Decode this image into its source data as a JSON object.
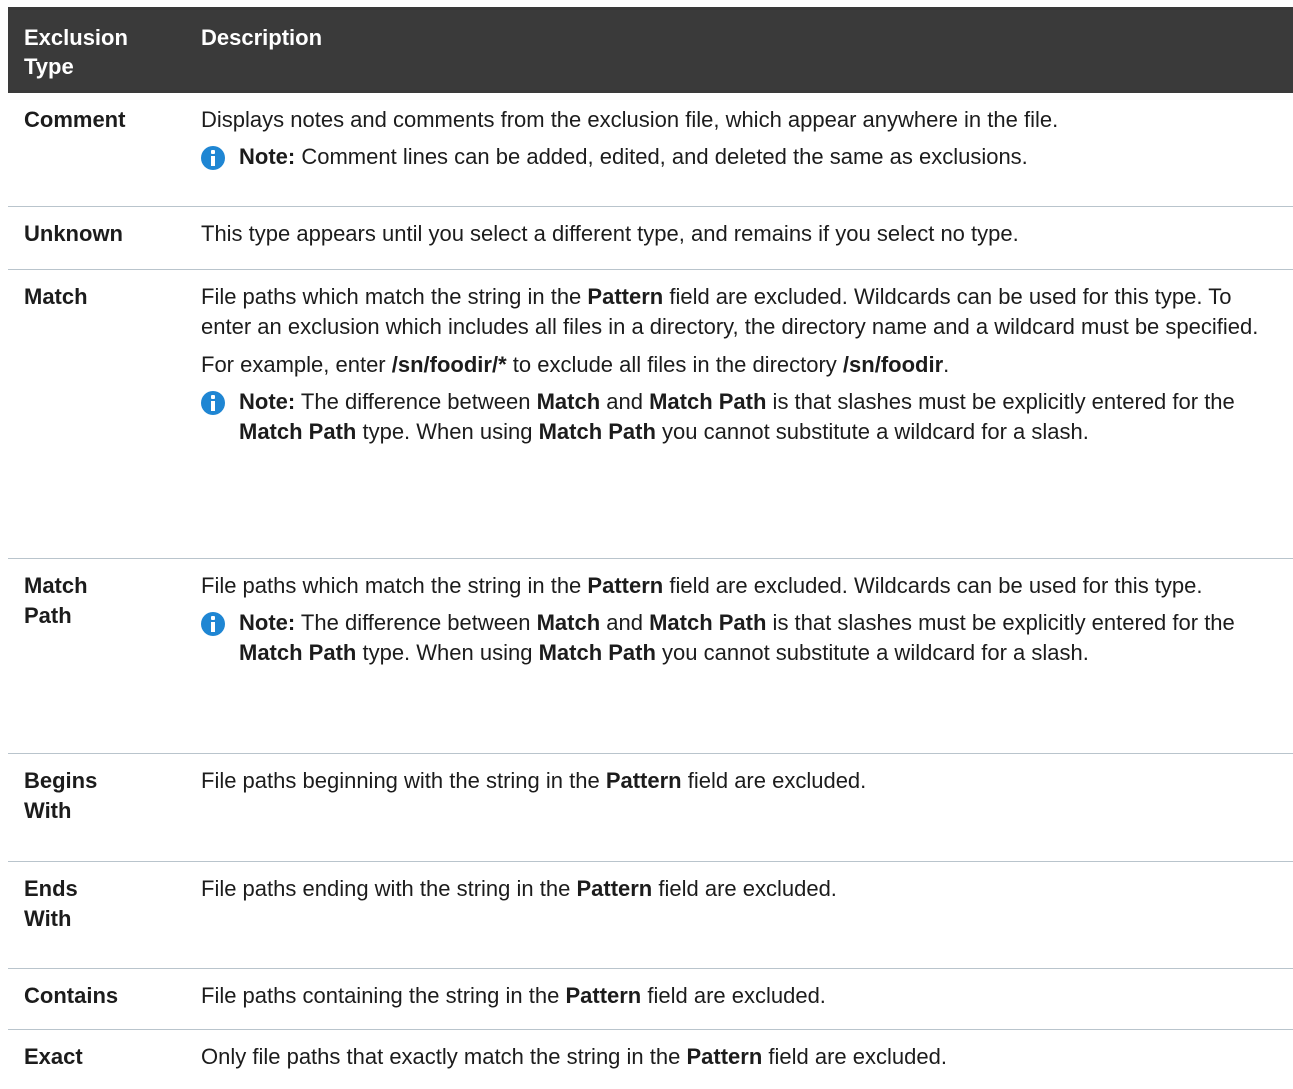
{
  "header": {
    "col_type": "Exclusion Type",
    "col_desc": "Description"
  },
  "note_label": "Note:",
  "rows": {
    "comment": {
      "type": "Comment",
      "text": "Displays notes and comments from the exclusion file, which appear anywhere in the file.",
      "note": "Comment lines can be added, edited, and deleted the same as exclusions."
    },
    "unknown": {
      "type": "Unknown",
      "text": "This type appears until you select a different type, and remains if you select no type."
    },
    "match": {
      "type": "Match",
      "p1_a": "File paths which match the string in the ",
      "pattern": "Pattern",
      "p1_b": " field are excluded. Wildcards can be used for this type. To enter an exclusion which includes all files in a directory, the directory name and a wildcard must be specified.",
      "p2_a": "For example, enter ",
      "p2_code1": "/sn/foodir/*",
      "p2_b": " to exclude all files in the directory ",
      "p2_code2": "/sn/foodir",
      "p2_c": ".",
      "note_a": " The difference between ",
      "note_match": "Match",
      "note_b": " and ",
      "note_matchpath": "Match Path",
      "note_c": " is that slashes must be explicitly entered for the ",
      "note_matchpath2": "Match Path",
      "note_d": " type. When using ",
      "note_matchpath3": "Match Path",
      "note_e": " you cannot substitute a wildcard for a slash."
    },
    "match_path": {
      "type": "Match Path",
      "p1_a": "File paths which match the string in the ",
      "pattern": "Pattern",
      "p1_b": " field are excluded. Wildcards can be used for this type.",
      "note_a": " The difference between ",
      "note_match": "Match",
      "note_b": " and ",
      "note_matchpath": "Match Path",
      "note_c": " is that slashes must be explicitly entered for the ",
      "note_matchpath2": "Match Path",
      "note_d": " type. When using ",
      "note_matchpath3": "Match Path",
      "note_e": " you cannot substitute a wildcard for a slash."
    },
    "begins_with": {
      "type": "Begins With",
      "a": "File paths beginning with the string in the ",
      "pattern": "Pattern",
      "b": " field are excluded."
    },
    "ends_with": {
      "type": "Ends With",
      "a": "File paths ending with the string in the ",
      "pattern": "Pattern",
      "b": " field are excluded."
    },
    "contains": {
      "type": "Contains",
      "a": "File paths containing the string in the ",
      "pattern": "Pattern",
      "b": " field are excluded."
    },
    "exact": {
      "type": "Exact",
      "a": "Only file paths that exactly match the string in the ",
      "pattern": "Pattern",
      "b": " field are excluded."
    }
  },
  "icons": {
    "note": "info-icon",
    "note_color": "#1f86d3",
    "header_bg": "#3a3a3a"
  }
}
